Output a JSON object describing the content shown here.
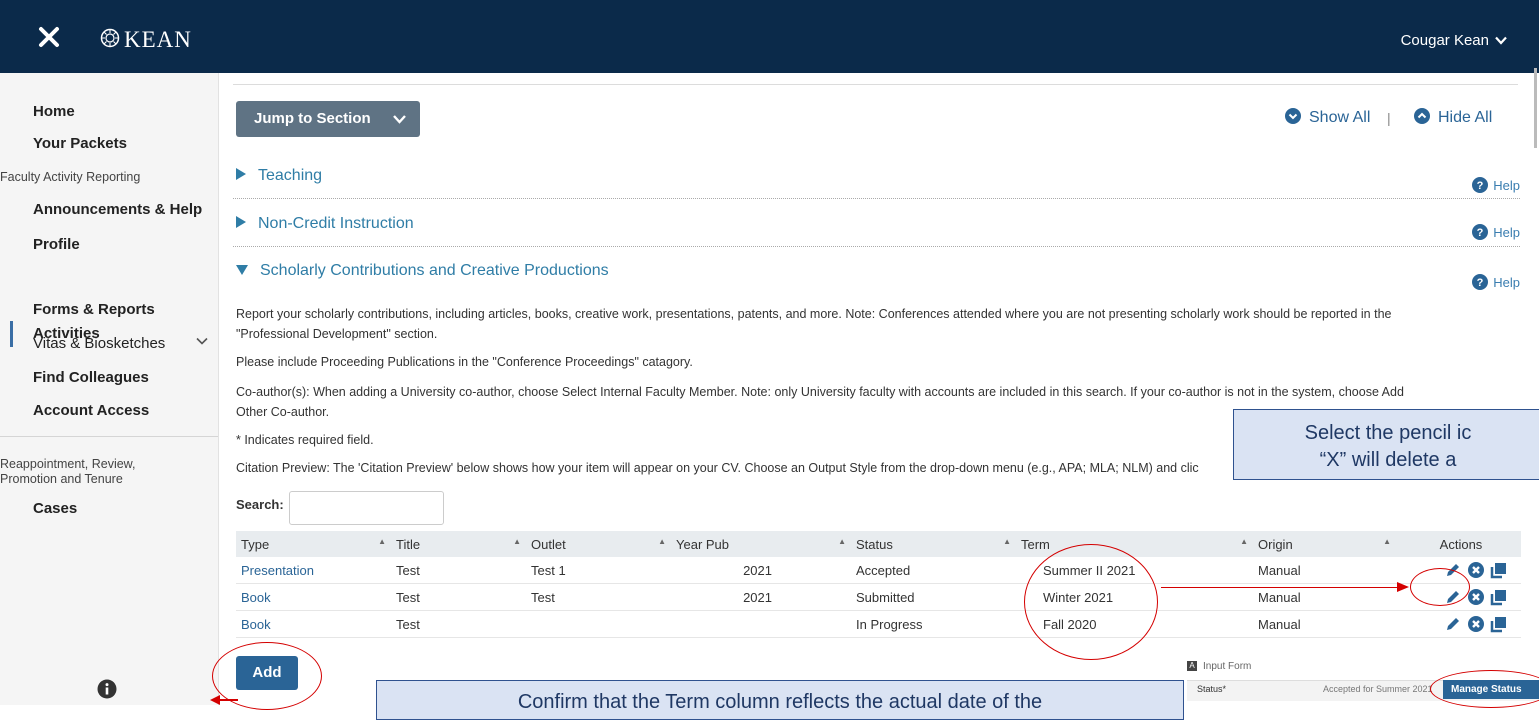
{
  "header": {
    "brand": "KEAN",
    "user_name": "Cougar Kean"
  },
  "sidebar": {
    "home": "Home",
    "your_packets": "Your Packets",
    "group_far": "Faculty Activity Reporting",
    "announcements": "Announcements & Help",
    "profile": "Profile",
    "activities": "Activities",
    "forms_reports": "Forms & Reports",
    "vitas": "Vitas & Biosketches",
    "find_colleagues": "Find Colleagues",
    "account_access": "Account Access",
    "group_rprt_1": "Reappointment, Review,",
    "group_rprt_2": "Promotion and Tenure",
    "cases": "Cases"
  },
  "toolbar": {
    "jump_label": "Jump to Section",
    "show_all": "Show All",
    "separator": "|",
    "hide_all": "Hide All"
  },
  "sections": {
    "teaching": "Teaching",
    "noncredit": "Non-Credit Instruction",
    "scholarly": "Scholarly Contributions and Creative Productions",
    "help": "Help"
  },
  "content": {
    "p1a": "Report your scholarly contributions, including articles, books, creative work, presentations, patents, and more. Note: Conferences attended where you are not presenting scholarly work should be reported in the",
    "p1b": "\"Professional Development\" section.",
    "p2": "Please include Proceeding Publications in the \"Conference Proceedings\" catagory.",
    "p3a": "Co-author(s): When adding a University co-author, choose Select Internal Faculty Member. Note: only University faculty with accounts are included in this search. If your co-author is not in the system, choose Add",
    "p3b": "Other Co-author.",
    "p4": "* Indicates required field.",
    "p5": "Citation Preview: The 'Citation Preview' below shows how your item will appear on your CV. Choose an Output Style from the drop-down menu (e.g., APA; MLA; NLM) and clic",
    "search_label": "Search:",
    "add_label": "Add"
  },
  "table": {
    "headers": [
      "Type",
      "Title",
      "Outlet",
      "Year Pub",
      "Status",
      "Term",
      "Origin",
      "Actions"
    ],
    "rows": [
      {
        "type": "Presentation",
        "title": "Test",
        "outlet": "Test 1",
        "year": "2021",
        "status": "Accepted",
        "term": "Summer II 2021",
        "origin": "Manual"
      },
      {
        "type": "Book",
        "title": "Test",
        "outlet": "Test",
        "year": "2021",
        "status": "Submitted",
        "term": "Winter 2021",
        "origin": "Manual"
      },
      {
        "type": "Book",
        "title": "Test",
        "outlet": "",
        "year": "",
        "status": "In Progress",
        "term": "Fall 2020",
        "origin": "Manual"
      }
    ]
  },
  "callouts": {
    "pencil_line1": "Select the pencil ic",
    "pencil_line2": "“X” will delete a",
    "term_note": "Confirm that the Term column reflects the actual date of the"
  },
  "thumbnail": {
    "letter": "A",
    "title": "Input Form",
    "status_label": "Status*",
    "status_value": "Accepted for Summer 2021",
    "manage_label": "Manage Status"
  },
  "colors": {
    "header_bg": "#0b2a4a",
    "link": "#2a6496",
    "section": "#2f7da6",
    "annotation_red": "#d40000",
    "callout_bg": "#dae3f3"
  }
}
